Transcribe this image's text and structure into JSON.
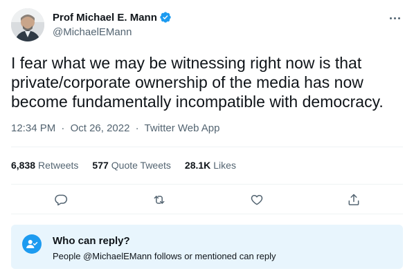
{
  "author": {
    "display_name": "Prof Michael E. Mann",
    "handle": "@MichaelEMann",
    "verified": true
  },
  "tweet": {
    "text": "I fear what we may be witnessing right now is that private/corporate ownership of the media has now become fundamentally incompatible with democracy.",
    "time": "12:34 PM",
    "date": "Oct 26, 2022",
    "source": "Twitter Web App",
    "separator": "·"
  },
  "stats": {
    "retweets_count": "6,838",
    "retweets_label": "Retweets",
    "quotes_count": "577",
    "quotes_label": "Quote Tweets",
    "likes_count": "28.1K",
    "likes_label": "Likes"
  },
  "actions": [
    "reply-icon",
    "retweet-icon",
    "like-icon",
    "share-icon"
  ],
  "reply_settings": {
    "title": "Who can reply?",
    "description": "People @MichaelEMann follows or mentioned can reply"
  },
  "colors": {
    "accent": "#1d9bf0",
    "text": "#0f1419",
    "secondary": "#536471",
    "info_bg": "#e8f5fd"
  }
}
